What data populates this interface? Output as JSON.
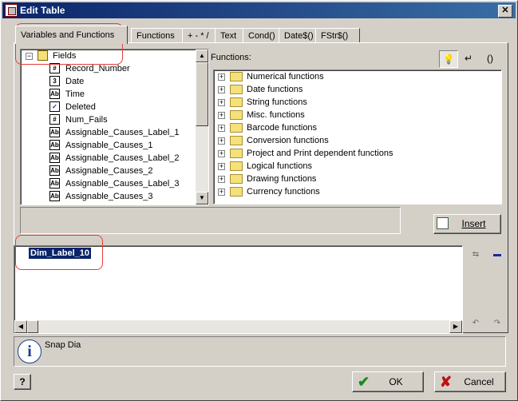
{
  "window": {
    "title": "Edit Table",
    "close_glyph": "✕"
  },
  "tabs": [
    {
      "label": "Variables and Functions"
    },
    {
      "label": "Functions"
    },
    {
      "label": "+ - * /"
    },
    {
      "label": "Text"
    },
    {
      "label": "Cond()"
    },
    {
      "label": "Date$()"
    },
    {
      "label": "FStr$()"
    }
  ],
  "variables_tree": {
    "root": "Fields",
    "items": [
      {
        "label": "Record_Number",
        "icon": "#"
      },
      {
        "label": "Date",
        "icon": "3"
      },
      {
        "label": "Time",
        "icon": "Ab"
      },
      {
        "label": "Deleted",
        "icon": "✓"
      },
      {
        "label": "Num_Fails",
        "icon": "#"
      },
      {
        "label": "Assignable_Causes_Label_1",
        "icon": "Ab"
      },
      {
        "label": "Assignable_Causes_1",
        "icon": "Ab"
      },
      {
        "label": "Assignable_Causes_Label_2",
        "icon": "Ab"
      },
      {
        "label": "Assignable_Causes_2",
        "icon": "Ab"
      },
      {
        "label": "Assignable_Causes_Label_3",
        "icon": "Ab"
      },
      {
        "label": "Assignable_Causes_3",
        "icon": "Ab"
      }
    ]
  },
  "functions_panel": {
    "label": "Functions:",
    "toolbar": {
      "bulb": "💡",
      "return": "↵",
      "parens": "()"
    },
    "items": [
      "Numerical functions",
      "Date functions",
      "String functions",
      "Misc. functions",
      "Barcode functions",
      "Conversion functions",
      "Project and Print dependent functions",
      "Logical functions",
      "Drawing functions",
      "Currency functions"
    ]
  },
  "insert_button": {
    "label": "Insert"
  },
  "editor": {
    "text": "Dim_Label_10"
  },
  "info": {
    "text": "Snap Dia"
  },
  "footer": {
    "help": "?",
    "ok": "OK",
    "cancel": "Cancel"
  },
  "colors": {
    "accent": "#0a246a",
    "highlight_outline": "#e2403a"
  }
}
